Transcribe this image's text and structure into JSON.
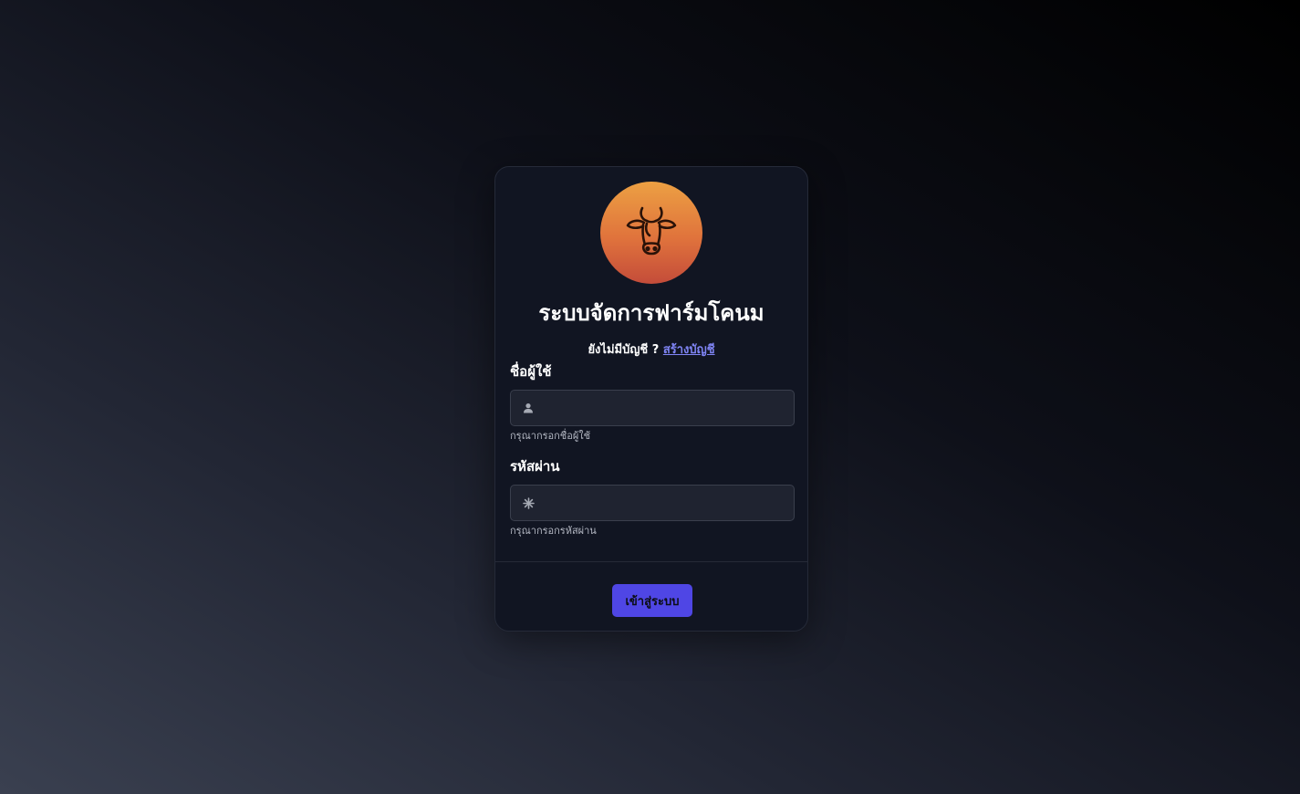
{
  "app": {
    "title": "ระบบจัดการฟาร์มโคนม"
  },
  "signup": {
    "prompt": "ยังไม่มีบัญชี ?",
    "link_label": "สร้างบัญชี"
  },
  "username": {
    "label": "ชื่อผู้ใช้",
    "value": "",
    "helper": "กรุณากรอกชื่อผู้ใช้",
    "icon": "user-icon"
  },
  "password": {
    "label": "รหัสผ่าน",
    "value": "",
    "helper": "กรุณากรอกรหัสผ่าน",
    "icon": "asterisk-icon"
  },
  "login": {
    "label": "เข้าสู่ระบบ"
  },
  "colors": {
    "accent": "#4f46e5",
    "link": "#7f84f4",
    "logo_top": "#eca043",
    "logo_bottom": "#c44c3a"
  },
  "logo_icon": "cow-head-icon"
}
